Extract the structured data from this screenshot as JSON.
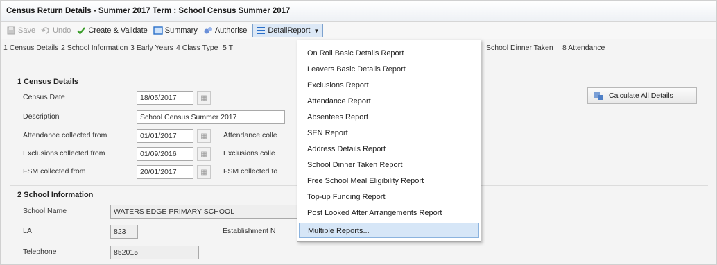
{
  "window": {
    "title": "Census Return Details - Summer 2017 Term : School Census Summer 2017"
  },
  "toolbar": {
    "save": "Save",
    "undo": "Undo",
    "create_validate": "Create & Validate",
    "summary": "Summary",
    "authorise": "Authorise",
    "detail_report": "DetailReport"
  },
  "tabs": [
    "1 Census Details",
    "2 School Information",
    "3 Early Years",
    "4 Class Type",
    "5 T",
    "School Dinner Taken",
    "8 Attendance"
  ],
  "census_details": {
    "heading": "1 Census Details",
    "census_date_label": "Census Date",
    "census_date": "18/05/2017",
    "description_label": "Description",
    "description": "School Census Summer 2017",
    "attendance_from_label": "Attendance collected from",
    "attendance_from": "01/01/2017",
    "attendance_to_label": "Attendance colle",
    "exclusions_from_label": "Exclusions collected from",
    "exclusions_from": "01/09/2016",
    "exclusions_to_label": "Exclusions colle",
    "fsm_from_label": "FSM collected from",
    "fsm_from": "20/01/2017",
    "fsm_to_label": "FSM collected to"
  },
  "calculate_all": "Calculate All Details",
  "school_info": {
    "heading": "2 School Information",
    "school_name_label": "School Name",
    "school_name": "WATERS EDGE PRIMARY SCHOOL",
    "la_label": "LA",
    "la": "823",
    "establishment_label": "Establishment N",
    "telephone_label": "Telephone",
    "telephone": "852015"
  },
  "menu": {
    "items": [
      "On Roll Basic Details Report",
      "Leavers Basic Details Report",
      "Exclusions Report",
      "Attendance Report",
      "Absentees Report",
      "SEN Report",
      "Address Details Report",
      "School Dinner Taken Report",
      "Free School Meal Eligibility Report",
      "Top-up Funding Report",
      "Post Looked After Arrangements Report",
      "Multiple Reports..."
    ],
    "highlighted_index": 11
  },
  "colors": {
    "accent": "#d6e6f7",
    "highlight_border": "#8bb3de"
  },
  "icons": {
    "save": "save-icon",
    "undo": "undo-icon",
    "create_validate": "checkmark-icon",
    "summary": "summary-icon",
    "authorise": "authorise-icon",
    "detail_report": "list-icon",
    "calendar": "calendar-icon",
    "calculate": "calculate-icon"
  }
}
